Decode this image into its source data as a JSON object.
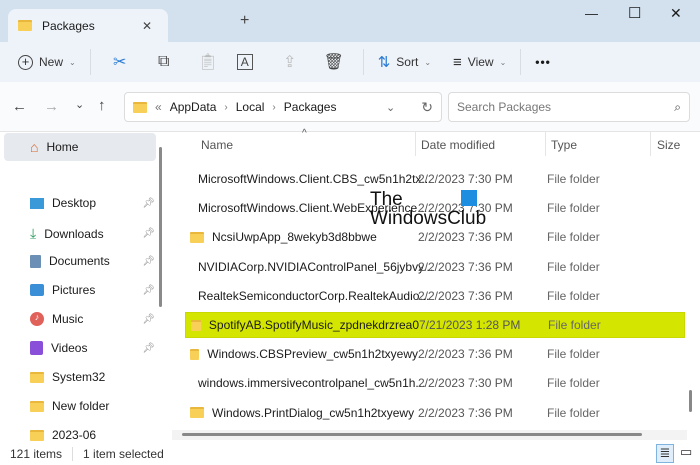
{
  "window": {
    "tab_title": "Packages",
    "new_tab": "+",
    "min": "—",
    "max": "☐",
    "close": "✕",
    "tab_close": "✕"
  },
  "toolbar": {
    "new": "New",
    "sort": "Sort",
    "view": "View",
    "more": "•••"
  },
  "address": {
    "crumbs": [
      "AppData",
      "Local",
      "Packages"
    ],
    "search_placeholder": "Search Packages"
  },
  "sidebar": {
    "home": "Home",
    "items": [
      {
        "label": "Desktop",
        "pinned": true
      },
      {
        "label": "Downloads",
        "pinned": true
      },
      {
        "label": "Documents",
        "pinned": true
      },
      {
        "label": "Pictures",
        "pinned": true
      },
      {
        "label": "Music",
        "pinned": true
      },
      {
        "label": "Videos",
        "pinned": true
      },
      {
        "label": "System32",
        "pinned": false
      },
      {
        "label": "New folder",
        "pinned": false
      },
      {
        "label": "2023-06",
        "pinned": false
      }
    ]
  },
  "columns": {
    "name": "Name",
    "date": "Date modified",
    "type": "Type",
    "size": "Size"
  },
  "files": [
    {
      "name": "MicrosoftWindows.Client.CBS_cw5n1h2tx...",
      "date": "2/2/2023 7:30 PM",
      "type": "File folder"
    },
    {
      "name": "MicrosoftWindows.Client.WebExperience...",
      "date": "2/2/2023 7:30 PM",
      "type": "File folder"
    },
    {
      "name": "NcsiUwpApp_8wekyb3d8bbwe",
      "date": "2/2/2023 7:36 PM",
      "type": "File folder"
    },
    {
      "name": "NVIDIACorp.NVIDIAControlPanel_56jybvy...",
      "date": "2/2/2023 7:36 PM",
      "type": "File folder"
    },
    {
      "name": "RealtekSemiconductorCorp.RealtekAudio...",
      "date": "2/2/2023 7:36 PM",
      "type": "File folder"
    },
    {
      "name": "SpotifyAB.SpotifyMusic_zpdnekdrzrea0",
      "date": "7/21/2023 1:28 PM",
      "type": "File folder",
      "selected": true
    },
    {
      "name": "Windows.CBSPreview_cw5n1h2txyewy",
      "date": "2/2/2023 7:36 PM",
      "type": "File folder"
    },
    {
      "name": "windows.immersivecontrolpanel_cw5n1h...",
      "date": "2/2/2023 7:30 PM",
      "type": "File folder"
    },
    {
      "name": "Windows.PrintDialog_cw5n1h2txyewy",
      "date": "2/2/2023 7:36 PM",
      "type": "File folder"
    }
  ],
  "status": {
    "count": "121 items",
    "selected": "1 item selected"
  },
  "watermark": {
    "line1": "The",
    "line2": "WindowsClub"
  },
  "colors": {
    "highlight": "#d4e600",
    "accent": "#0067c0"
  }
}
